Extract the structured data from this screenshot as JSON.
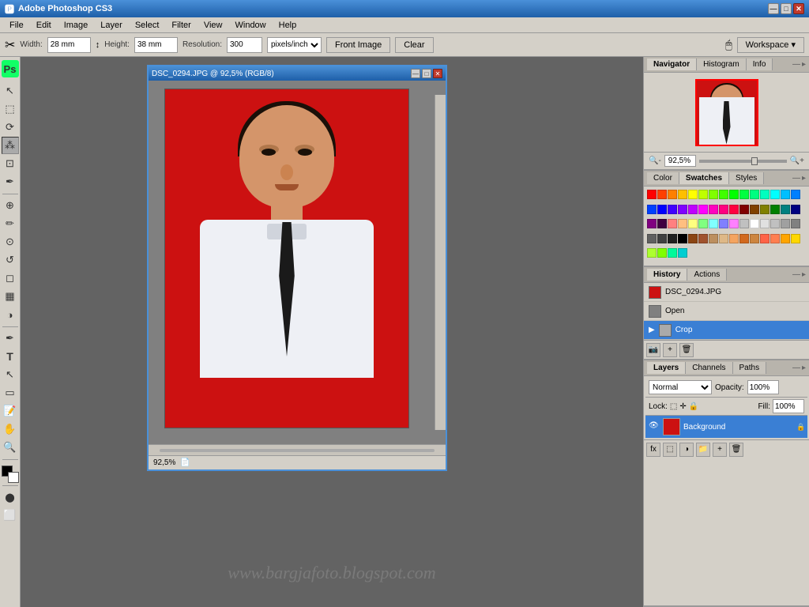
{
  "app": {
    "title": "Adobe Photoshop CS3",
    "ps_label": "Ps"
  },
  "titlebar": {
    "min": "—",
    "max": "□",
    "close": "✕"
  },
  "menubar": {
    "items": [
      "File",
      "Edit",
      "Image",
      "Layer",
      "Select",
      "Filter",
      "View",
      "Window",
      "Help"
    ]
  },
  "optionsbar": {
    "width_label": "Width:",
    "width_value": "28 mm",
    "height_label": "Height:",
    "height_value": "38 mm",
    "resolution_label": "Resolution:",
    "resolution_value": "300",
    "resolution_unit": "pixels/inch",
    "front_image_btn": "Front Image",
    "clear_btn": "Clear",
    "workspace_btn": "Workspace ▾"
  },
  "document": {
    "title": "DSC_0294.JPG @ 92,5% (RGB/8)",
    "zoom": "92,5%",
    "tb_min": "—",
    "tb_max": "□",
    "tb_close": "✕"
  },
  "navigator": {
    "tab": "Navigator",
    "histogram_tab": "Histogram",
    "info_tab": "Info",
    "zoom_value": "92,5%",
    "close": "×"
  },
  "color_panel": {
    "color_tab": "Color",
    "swatches_tab": "Swatches",
    "styles_tab": "Styles",
    "close": "×"
  },
  "history_panel": {
    "history_tab": "History",
    "actions_tab": "Actions",
    "close": "×",
    "items": [
      {
        "label": "DSC_0294.JPG",
        "active": false
      },
      {
        "label": "Open",
        "active": false
      },
      {
        "label": "Crop",
        "active": true
      }
    ]
  },
  "layers_panel": {
    "layers_tab": "Layers",
    "channels_tab": "Channels",
    "paths_tab": "Paths",
    "close": "×",
    "mode": "Normal",
    "opacity": "100%",
    "fill": "100%",
    "lock_label": "Lock:",
    "layer_name": "Background"
  },
  "watermark": "www.bargjafoto.blogspot.com",
  "swatches": {
    "colors": [
      "#ff0000",
      "#ff4000",
      "#ff8000",
      "#ffbf00",
      "#ffff00",
      "#bfff00",
      "#80ff00",
      "#40ff00",
      "#00ff00",
      "#00ff40",
      "#00ff80",
      "#00ffbf",
      "#00ffff",
      "#00bfff",
      "#0080ff",
      "#0040ff",
      "#0000ff",
      "#4000ff",
      "#8000ff",
      "#bf00ff",
      "#ff00ff",
      "#ff00bf",
      "#ff0080",
      "#ff0040",
      "#800000",
      "#804000",
      "#808000",
      "#008000",
      "#008080",
      "#000080",
      "#800080",
      "#400040",
      "#ff8080",
      "#ffbf80",
      "#ffff80",
      "#80ff80",
      "#80ffff",
      "#8080ff",
      "#ff80ff",
      "#c0c0c0",
      "#ffffff",
      "#e0e0e0",
      "#c0c0c0",
      "#a0a0a0",
      "#808080",
      "#606060",
      "#404040",
      "#202020",
      "#000000",
      "#8b4513",
      "#a0522d",
      "#bc8f5f",
      "#deb887",
      "#f4a460",
      "#d2691e",
      "#cd853f",
      "#ff6347",
      "#ff7f50",
      "#ffa500",
      "#ffd700",
      "#adff2f",
      "#7fff00",
      "#00fa9a",
      "#00ced1"
    ]
  }
}
